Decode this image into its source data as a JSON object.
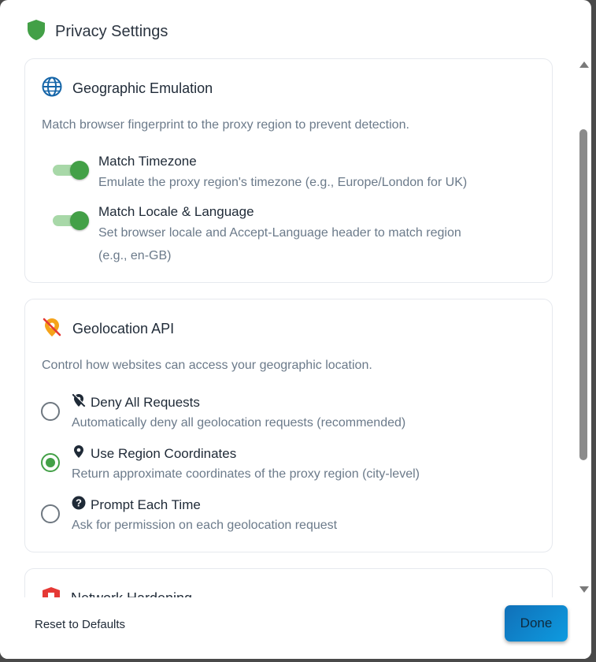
{
  "dialog": {
    "title": "Privacy Settings",
    "icon": "shield-icon",
    "accent_color": "#43a047"
  },
  "geographic": {
    "title": "Geographic Emulation",
    "icon": "globe-icon",
    "description": "Match browser fingerprint to the proxy region to prevent detection.",
    "options": [
      {
        "label": "Match Timezone",
        "sub": "Emulate the proxy region's timezone (e.g., Europe/London for UK)",
        "enabled": true
      },
      {
        "label": "Match Locale & Language",
        "sub_line1": "Set browser locale and Accept-Language header to match region",
        "sub_line2": "(e.g., en-GB)",
        "enabled": true
      }
    ]
  },
  "geolocation": {
    "title": "Geolocation API",
    "icon": "location-off-icon",
    "description": "Control how websites can access your geographic location.",
    "selected": "Use Region Coordinates",
    "options": [
      {
        "label": "Deny All Requests",
        "sub": "Automatically deny all geolocation requests (recommended)",
        "icon": "location-off-icon"
      },
      {
        "label": "Use Region Coordinates",
        "sub": "Return approximate coordinates of the proxy region (city-level)",
        "icon": "map-pin-icon"
      },
      {
        "label": "Prompt Each Time",
        "sub": "Ask for permission on each geolocation request",
        "icon": "question-icon"
      }
    ]
  },
  "network": {
    "title": "Network Hardening",
    "icon": "shield-red-icon"
  },
  "footer": {
    "reset_label": "Reset to Defaults",
    "done_label": "Done"
  }
}
